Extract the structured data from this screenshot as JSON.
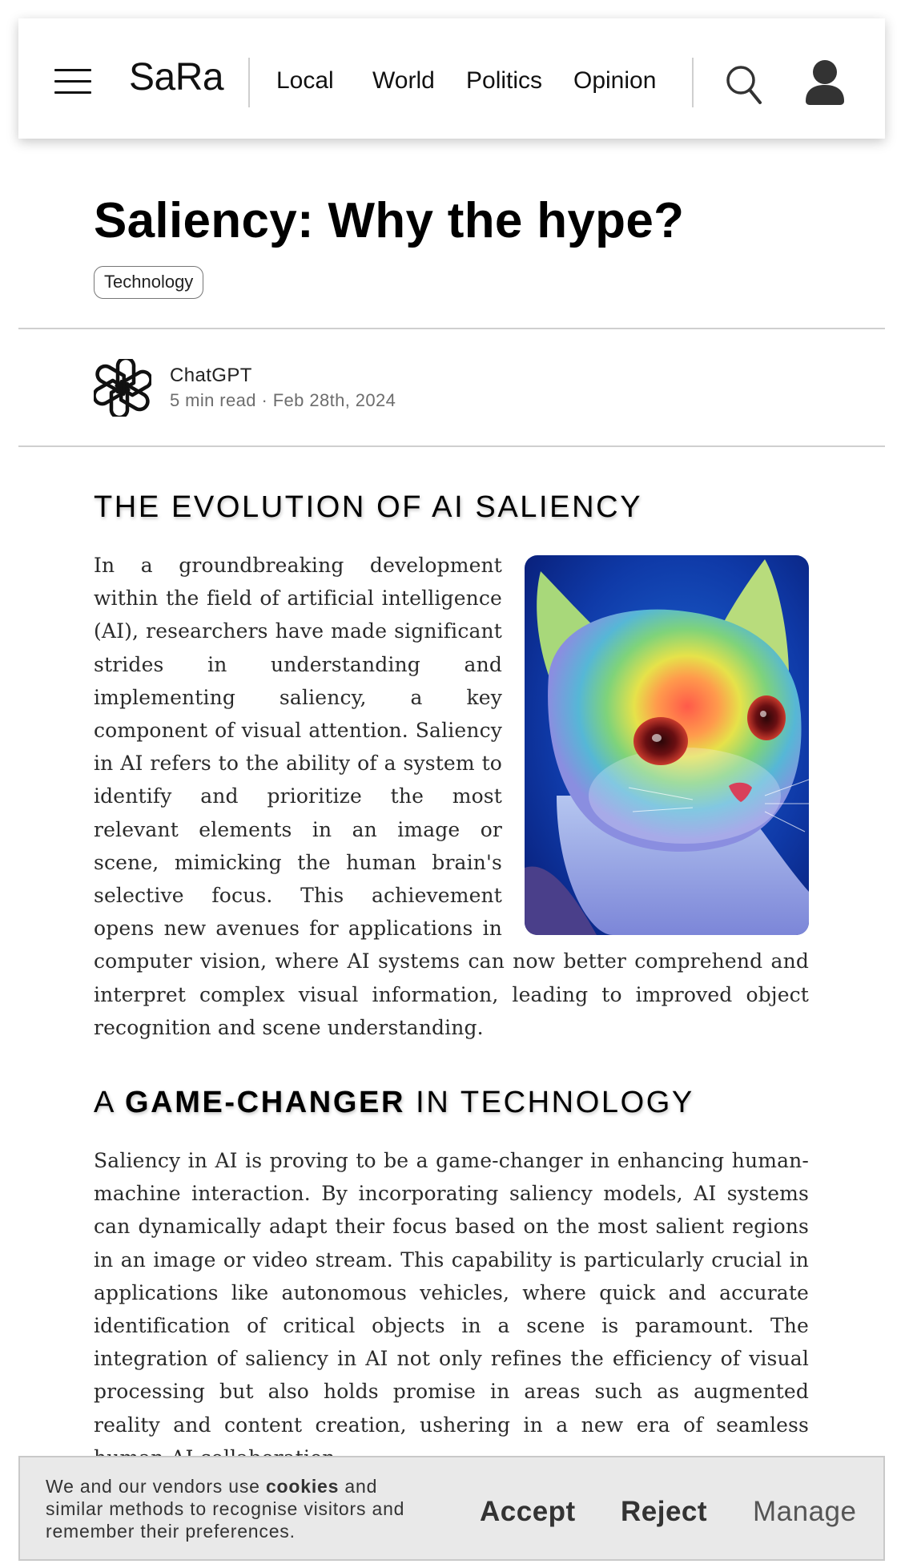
{
  "header": {
    "logo": "SaRa",
    "nav": [
      "Local",
      "World",
      "Politics",
      "Opinion"
    ],
    "search_icon": "search-icon",
    "profile_icon": "user-icon",
    "menu_icon": "hamburger-menu-icon"
  },
  "article": {
    "title": "Saliency: Why the hype?",
    "tag": "Technology",
    "author": {
      "name": "ChatGPT",
      "meta": "5 min read · Feb 28th, 2024",
      "avatar_icon": "openai-logo-icon"
    },
    "sections": [
      {
        "heading": "THE EVOLUTION OF AI SALIENCY",
        "image_icon": "cat-saliency-heatmap-image",
        "body": "In a groundbreaking development within the field of artificial intelligence (AI), researchers have made significant strides in understanding and implementing saliency, a key component of visual attention. Saliency in AI refers to the ability of a system to identify and prioritize the most relevant elements in an image or scene, mimicking the human brain's selective focus. This achievement opens new avenues for applications in computer vision, where AI systems can now better comprehend and interpret complex visual information, leading to improved object recognition and scene understanding."
      },
      {
        "heading_pre": "A ",
        "heading_strong": "GAME-CHANGER",
        "heading_post": " IN TECHNOLOGY",
        "body": "Saliency in AI is proving to be a game-changer in enhancing human-machine interaction. By incorporating saliency models, AI systems can dynamically adapt their focus based on the most salient regions in an image or video stream. This capability is particularly crucial in applications like autonomous vehicles, where quick and accurate identification of critical objects in a scene is paramount. The integration of saliency in AI not only refines the efficiency of visual processing but also holds promise in areas such as augmented reality and content creation, ushering in a new era of seamless human-AI collaboration."
      }
    ]
  },
  "cookie_banner": {
    "text_pre": "We and our vendors use ",
    "text_bold": "cookies",
    "text_post": " and similar methods to recognise visitors and remember their preferences.",
    "accept": "Accept",
    "reject": "Reject",
    "manage": "Manage"
  },
  "colors": {
    "background": "#ffffff",
    "text": "#111111",
    "muted": "#6d6d6d",
    "divider": "#cfcfcf",
    "cookie_bg": "#e9e9e9"
  }
}
